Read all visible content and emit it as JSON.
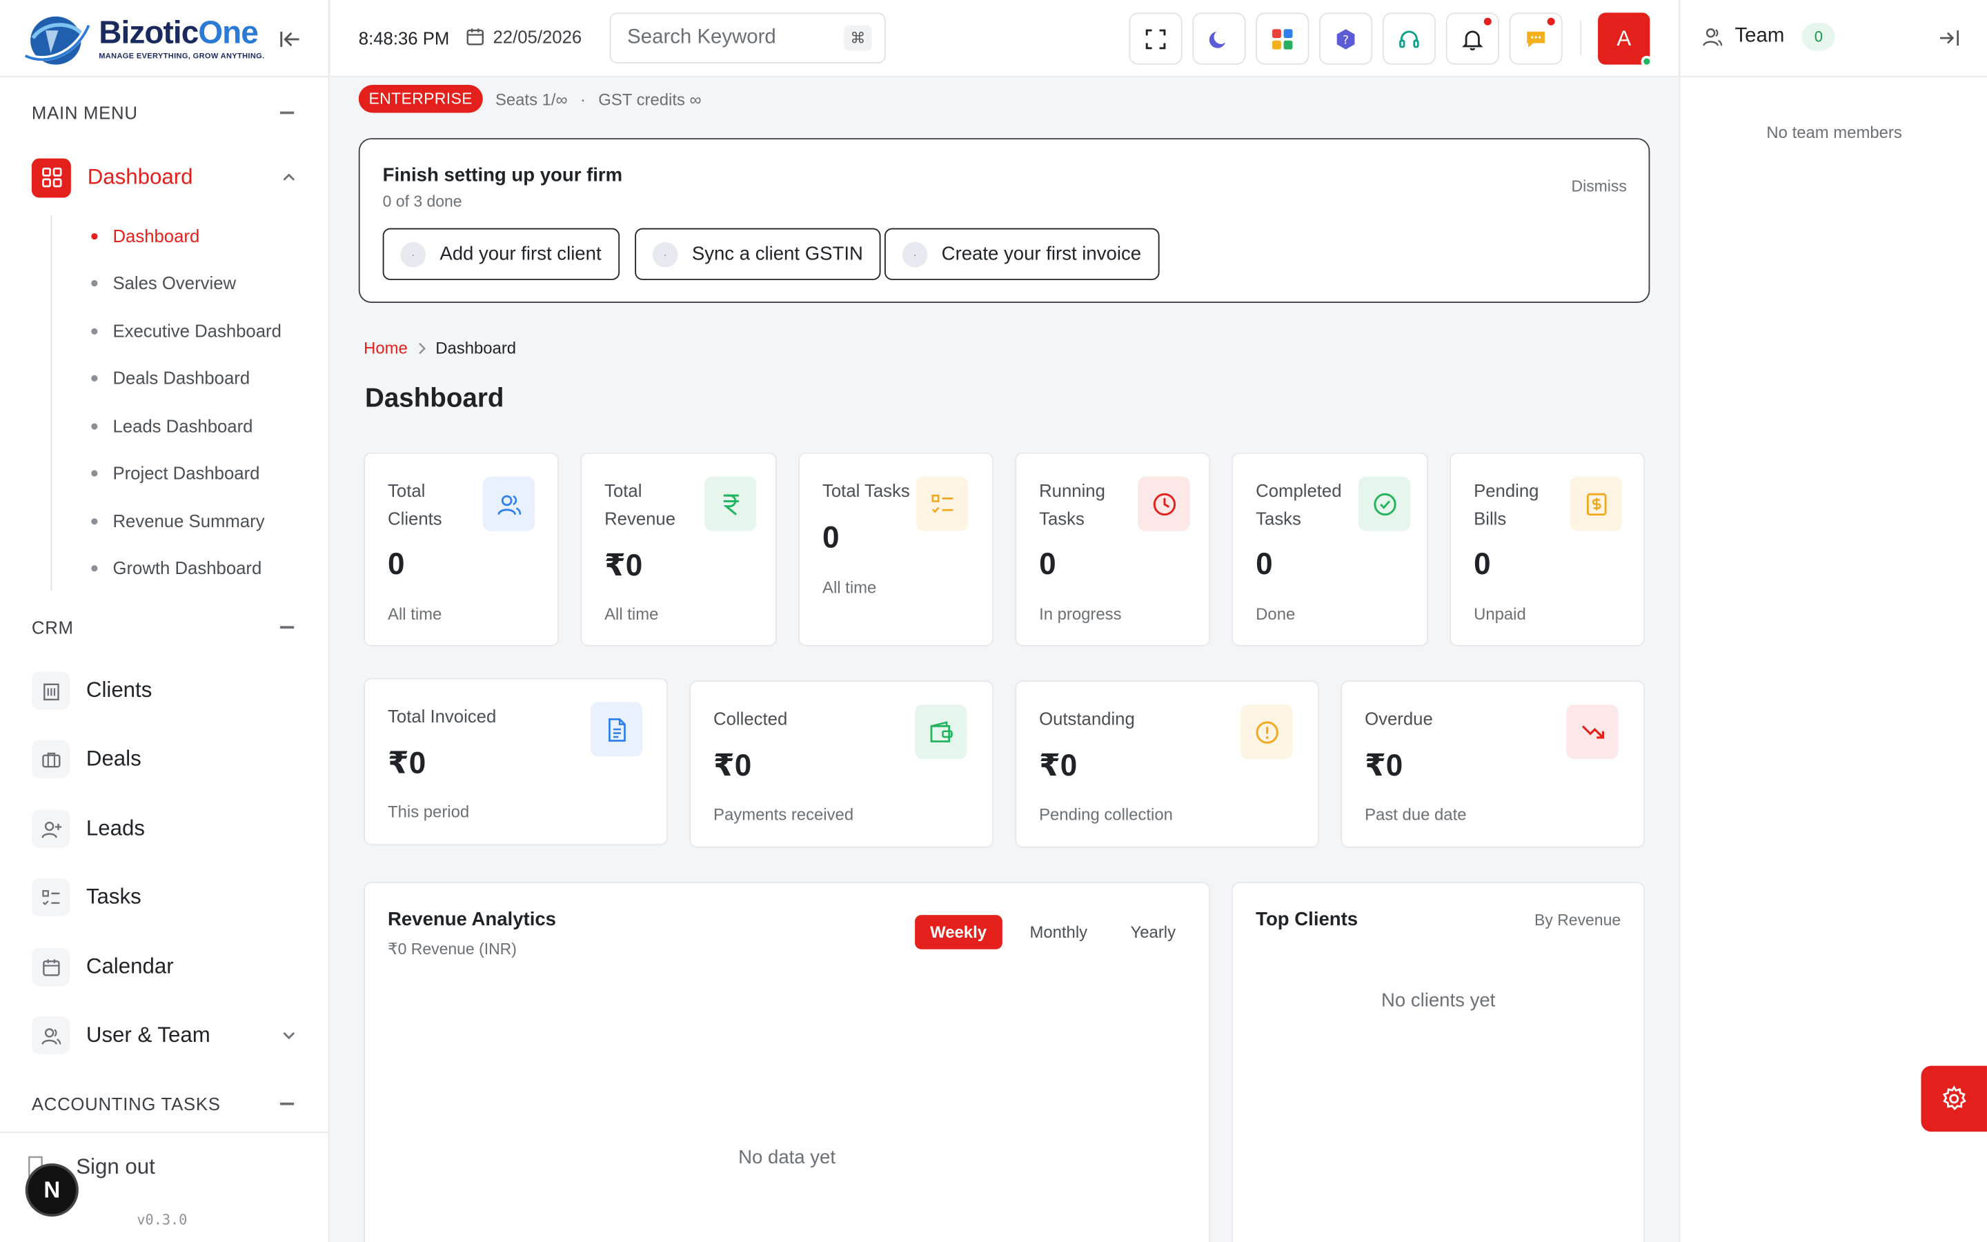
{
  "brand": {
    "name_part1": "Bizotic",
    "name_part2": "One",
    "tagline": "MANAGE EVERYTHING, GROW ANYTHING."
  },
  "colors": {
    "accent": "#e3201b",
    "success": "#22b35e"
  },
  "sidebar": {
    "main_menu_label": "MAIN MENU",
    "dashboard_label": "Dashboard",
    "dashboard_sub": [
      {
        "label": "Dashboard",
        "active": true
      },
      {
        "label": "Sales Overview"
      },
      {
        "label": "Executive Dashboard"
      },
      {
        "label": "Deals Dashboard"
      },
      {
        "label": "Leads Dashboard"
      },
      {
        "label": "Project Dashboard"
      },
      {
        "label": "Revenue Summary"
      },
      {
        "label": "Growth Dashboard"
      }
    ],
    "crm_label": "CRM",
    "crm_items": [
      {
        "label": "Clients",
        "icon": "building-icon"
      },
      {
        "label": "Deals",
        "icon": "briefcase-icon"
      },
      {
        "label": "Leads",
        "icon": "user-plus-icon"
      },
      {
        "label": "Tasks",
        "icon": "checklist-icon"
      },
      {
        "label": "Calendar",
        "icon": "calendar-icon"
      },
      {
        "label": "User & Team",
        "icon": "users-icon"
      }
    ],
    "accounting_label": "ACCOUNTING TASKS",
    "sign_out": "Sign out",
    "n_badge": "N",
    "version": "v0.3.0"
  },
  "topbar": {
    "time": "8:48:36 PM",
    "date": "22/05/2026",
    "search_placeholder": "Search Keyword",
    "search_shortcut": "⌘",
    "avatar_initial": "A"
  },
  "right_panel": {
    "title": "Team",
    "count": "0",
    "empty": "No team members"
  },
  "plan": {
    "badge": "ENTERPRISE",
    "seats": "Seats 1/∞",
    "separator": "·",
    "gst": "GST credits ∞"
  },
  "setup": {
    "title": "Finish setting up your firm",
    "progress": "0 of 3 done",
    "dismiss": "Dismiss",
    "step_marker": "·",
    "steps": [
      "Add your first client",
      "Sync a client GSTIN",
      "Create your first invoice"
    ]
  },
  "breadcrumb": {
    "home": "Home",
    "current": "Dashboard"
  },
  "page_title": "Dashboard",
  "stats_row1": [
    {
      "label": "Total Clients",
      "value": "0",
      "sub": "All time",
      "icon": "users-icon"
    },
    {
      "label": "Total Revenue",
      "value": "₹0",
      "sub": "All time",
      "icon": "rupee-icon"
    },
    {
      "label": "Total Tasks",
      "value": "0",
      "sub": "All time",
      "icon": "list-check-icon"
    },
    {
      "label": "Running Tasks",
      "value": "0",
      "sub": "In progress",
      "icon": "clock-icon"
    },
    {
      "label": "Completed Tasks",
      "value": "0",
      "sub": "Done",
      "icon": "check-circle-icon"
    },
    {
      "label": "Pending Bills",
      "value": "0",
      "sub": "Unpaid",
      "icon": "bill-icon"
    }
  ],
  "stats_row2": [
    {
      "label": "Total Invoiced",
      "value": "₹0",
      "sub": "This period",
      "icon": "document-icon"
    },
    {
      "label": "Collected",
      "value": "₹0",
      "sub": "Payments received",
      "icon": "wallet-icon"
    },
    {
      "label": "Outstanding",
      "value": "₹0",
      "sub": "Pending collection",
      "icon": "alert-circle-icon"
    },
    {
      "label": "Overdue",
      "value": "₹0",
      "sub": "Past due date",
      "icon": "trending-down-icon"
    }
  ],
  "revenue": {
    "title": "Revenue Analytics",
    "subtitle": "₹0 Revenue (INR)",
    "tabs": [
      "Weekly",
      "Monthly",
      "Yearly"
    ],
    "active_tab": "Weekly",
    "empty": "No data yet"
  },
  "top_clients": {
    "title": "Top Clients",
    "sort": "By Revenue",
    "empty": "No clients yet"
  }
}
